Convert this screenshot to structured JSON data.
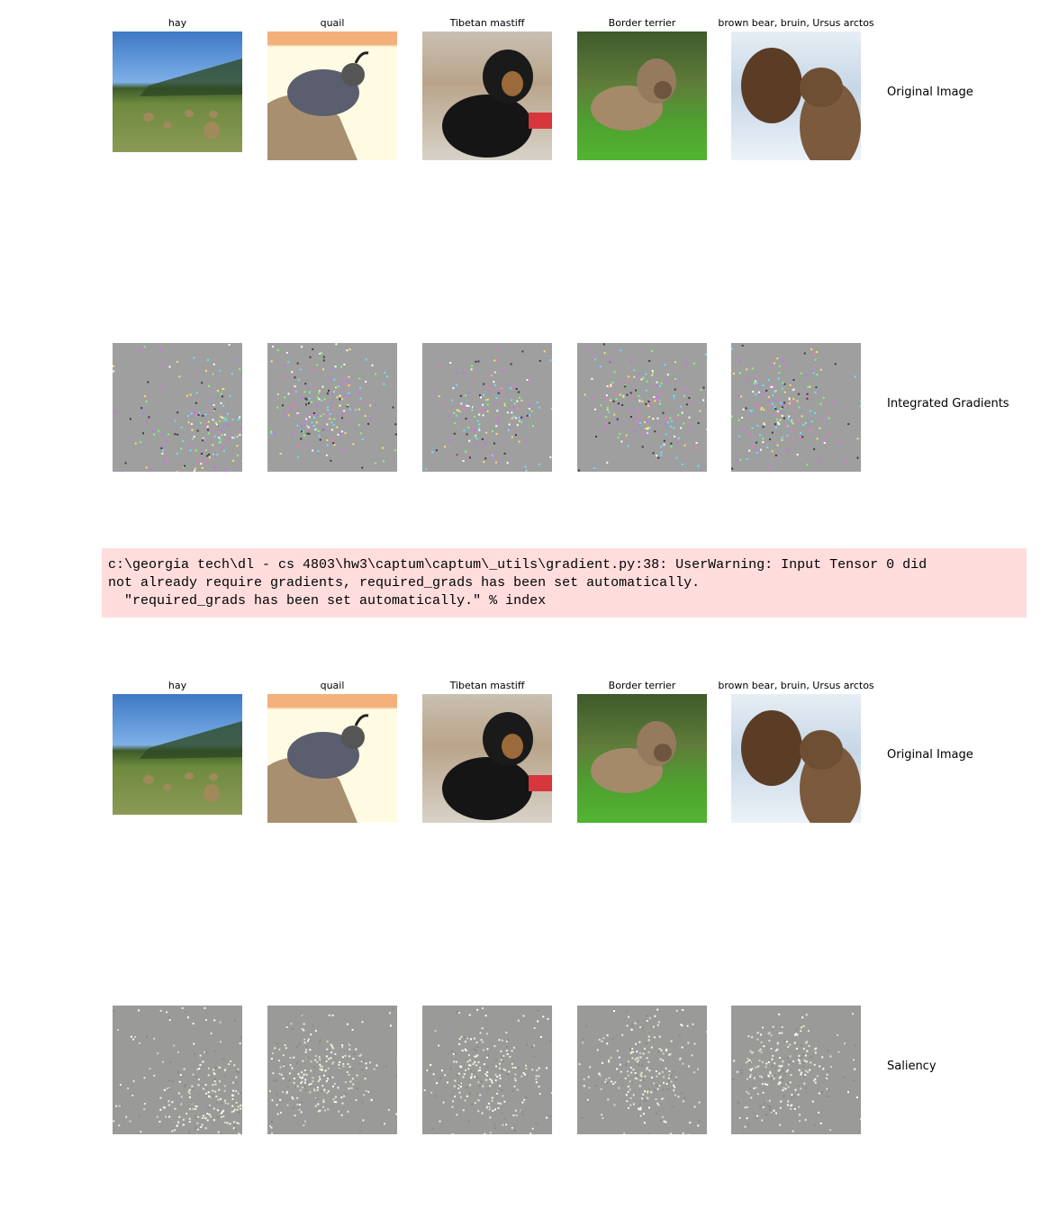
{
  "titles": [
    "hay",
    "quail",
    "Tibetan mastiff",
    "Border terrier",
    "brown bear, bruin, Ursus arctos"
  ],
  "block1": {
    "row1_label": "Original Image",
    "row2_label": "Integrated Gradients"
  },
  "warning": {
    "text": "c:\\georgia tech\\dl - cs 4803\\hw3\\captum\\captum\\_utils\\gradient.py:38: UserWarning: Input Tensor 0 did\nnot already require gradients, required_grads has been set automatically.\n  \"required_grads has been set automatically.\" % index",
    "background": "#ffdddd"
  },
  "block2": {
    "row1_label": "Original Image",
    "row2_label": "Saliency"
  }
}
